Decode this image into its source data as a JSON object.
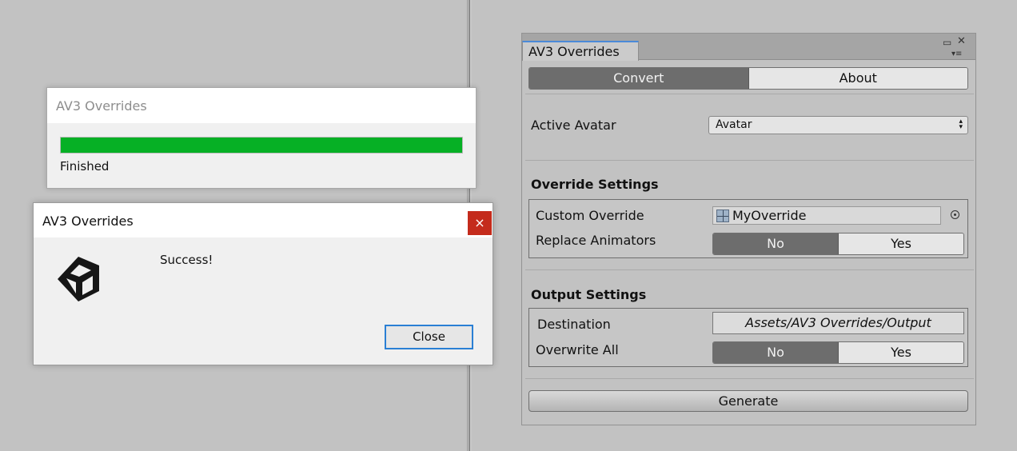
{
  "progress_window": {
    "title": "AV3 Overrides",
    "progress": 1.0,
    "status": "Finished",
    "bar_color": "#06b025"
  },
  "success_dialog": {
    "title": "AV3 Overrides",
    "close_icon": "×",
    "logo_icon": "unity-logo-icon",
    "message": "Success!",
    "close_button": "Close"
  },
  "panel": {
    "tab_title": "AV3 Overrides",
    "window_controls": {
      "maximize": "▭",
      "close": "✕",
      "menu": "▾≡"
    },
    "modes": {
      "convert": "Convert",
      "about": "About",
      "selected": "Convert"
    },
    "active_avatar": {
      "label": "Active Avatar",
      "value": "Avatar",
      "arrow": "▴▾"
    },
    "override_settings": {
      "heading": "Override Settings",
      "custom_override_label": "Custom Override",
      "custom_override_value": "MyOverride",
      "replace_animators_label": "Replace Animators",
      "no": "No",
      "yes": "Yes",
      "selected": "No"
    },
    "output_settings": {
      "heading": "Output Settings",
      "destination_label": "Destination",
      "destination_value": "Assets/AV3 Overrides/Output",
      "overwrite_all_label": "Overwrite All",
      "no": "No",
      "yes": "Yes",
      "selected": "No"
    },
    "generate_button": "Generate",
    "accent_color": "#4b8ad8"
  }
}
